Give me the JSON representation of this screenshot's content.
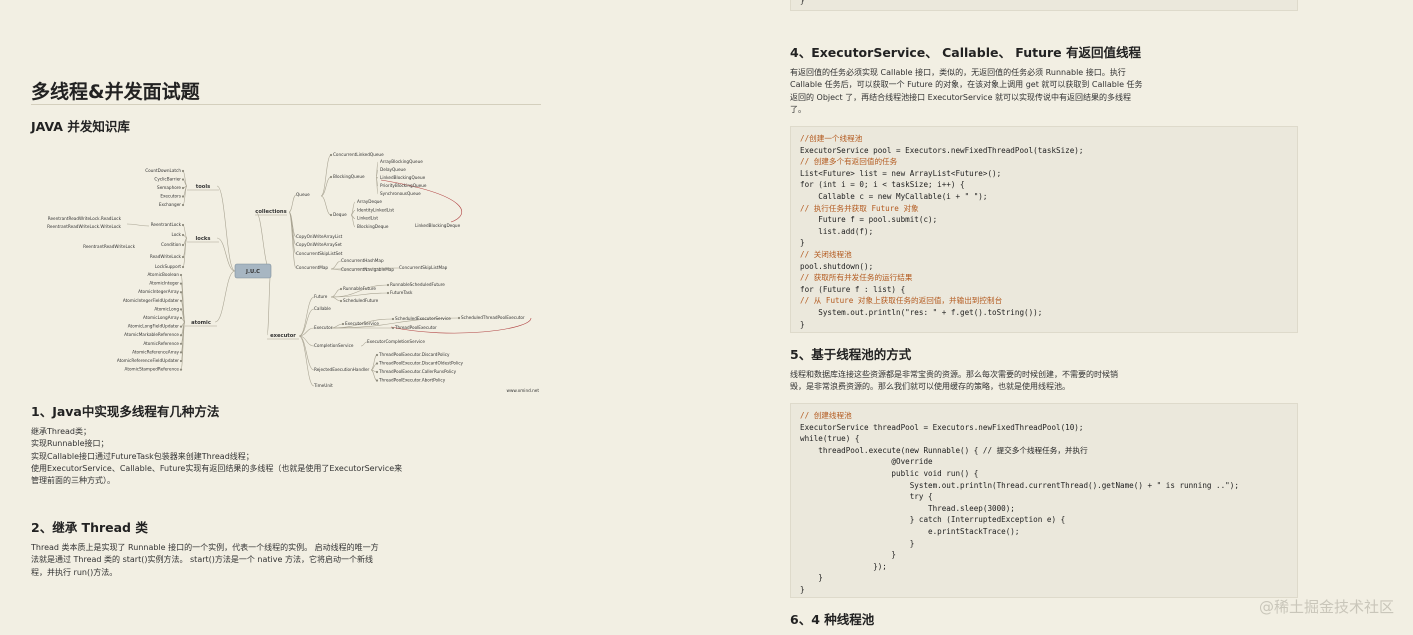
{
  "left": {
    "title": "多线程&并发面试题",
    "subtitle": "JAVA 并发知识库",
    "mindmap": {
      "center": "J.U.C",
      "categories": [
        "tools",
        "locks",
        "atomic",
        "collections",
        "executor"
      ],
      "tools_items": [
        "CountDownLatch",
        "CyclicBarrier",
        "Semaphore",
        "Executors",
        "Exchanger"
      ],
      "locks_items": [
        "ReentrantLock",
        "Lock",
        "Condition",
        "ReadWriteLock",
        "LockSupport"
      ],
      "locks_sub": [
        "ReentrantReadWriteLock.ReadLock",
        "ReentrantReadWriteLock.WriteLock",
        "ReentrantReadWriteLock"
      ],
      "atomic_items": [
        "AtomicBoolean",
        "AtomicInteger",
        "AtomicIntegerArray",
        "AtomicIntegerFieldUpdater",
        "AtomicLong",
        "AtomicLongArray",
        "AtomicLongFieldUpdater",
        "AtomicMarkableReference",
        "AtomicReference",
        "AtomicReferenceArray",
        "AtomicReferenceFieldUpdater",
        "AtomicStampedReference"
      ],
      "collections_items": [
        "Queue",
        "CopyOnWriteArrayList",
        "CopyOnWriteArraySet",
        "ConcurrentSkipListSet",
        "ConcurrentMap"
      ],
      "queue_items": [
        "ConcurrentLinkedQueue",
        "BlockingQueue",
        "Deque"
      ],
      "blockingqueue_items": [
        "ArrayBlockingQueue",
        "DelayQueue",
        "LinkedBlockingQueue",
        "PriorityBlockingQueue",
        "SynchronousQueue"
      ],
      "deque_items": [
        "ArrayDeque",
        "IdentityLinkedList",
        "LinkedList",
        "BlockingDeque"
      ],
      "blockingdeque_items": [
        "LinkedBlockingDeque"
      ],
      "map_items": [
        "ConcurrentHashMap",
        "ConcurrentNavigableMap",
        "ConcurrentSkipListMap"
      ],
      "executor_items": [
        "Future",
        "Callable",
        "Executor",
        "CompletionService",
        "RejectedExecutionHandler",
        "TimeUnit"
      ],
      "future_items": [
        "RunnableFuture",
        "ScheduledFuture",
        "RunnableScheduledFuture",
        "FutureTask"
      ],
      "executor_sub": [
        "ExecutorService",
        "ScheduledExecutorService",
        "ThreadPoolExecutor",
        "ScheduledThreadPoolExecutor"
      ],
      "completion_items": [
        "ExecutorCompletionService"
      ],
      "rejected_items": [
        "ThreadPoolExecutor.DiscardPolicy",
        "ThreadPoolExecutor.DiscardOldestPolicy",
        "ThreadPoolExecutor.CallerRunsPolicy",
        "ThreadPoolExecutor.AbortPolicy"
      ],
      "credit": "www.xmind.net"
    },
    "sec1": {
      "title": "1、Java中实现多线程有几种方法",
      "lines": [
        "继承Thread类；",
        "实现Runnable接口；",
        "实现Callable接口通过FutureTask包装器来创建Thread线程；",
        "使用ExecutorService、Callable、Future实现有返回结果的多线程（也就是使用了ExecutorService来",
        "管理前面的三种方式）。"
      ]
    },
    "sec2": {
      "title": "2、继承 Thread 类",
      "lines": [
        "Thread 类本质上是实现了 Runnable 接口的一个实例，代表一个线程的实例。 启动线程的唯一方",
        "法就是通过 Thread 类的 start()实例方法。 start()方法是一个 native 方法，它将启动一个新线",
        "程，并执行 run()方法。"
      ]
    }
  },
  "right": {
    "top_code_tail": "}",
    "sec4": {
      "title": "4、ExecutorService、 Callable、 Future 有返回值线程",
      "lines": [
        "有返回值的任务必须实现 Callable 接口，类似的，无返回值的任务必须 Runnable 接口。执行",
        "Callable 任务后，可以获取一个 Future 的对象，在该对象上调用 get 就可以获取到 Callable 任务",
        "返回的 Object 了，再结合线程池接口 ExecutorService 就可以实现传说中有返回结果的多线程",
        "了。"
      ],
      "code": [
        {
          "t": "//创建一个线程池",
          "c": true
        },
        {
          "t": "ExecutorService pool = Executors.newFixedThreadPool(taskSize);",
          "c": false
        },
        {
          "t": "// 创建多个有返回值的任务",
          "c": true
        },
        {
          "t": "List<Future> list = new ArrayList<Future>();",
          "c": false
        },
        {
          "t": "for (int i = 0; i < taskSize; i++) {",
          "c": false
        },
        {
          "t": "    Callable c = new MyCallable(i + \" \");",
          "c": false
        },
        {
          "t": "// 执行任务并获取 Future 对象",
          "c": true
        },
        {
          "t": "    Future f = pool.submit(c);",
          "c": false
        },
        {
          "t": "    list.add(f);",
          "c": false
        },
        {
          "t": "}",
          "c": false
        },
        {
          "t": "// 关闭线程池",
          "c": true
        },
        {
          "t": "pool.shutdown();",
          "c": false
        },
        {
          "t": "// 获取所有并发任务的运行结果",
          "c": true
        },
        {
          "t": "for (Future f : list) {",
          "c": false
        },
        {
          "t": "// 从 Future 对象上获取任务的返回值，并输出到控制台",
          "c": true
        },
        {
          "t": "    System.out.println(\"res: \" + f.get().toString());",
          "c": false
        },
        {
          "t": "}",
          "c": false
        }
      ]
    },
    "sec5": {
      "title": "5、基于线程池的方式",
      "lines": [
        "线程和数据库连接这些资源都是非常宝贵的资源。那么每次需要的时候创建，不需要的时候销",
        "毁，是非常浪费资源的。那么我们就可以使用缓存的策略，也就是使用线程池。"
      ],
      "code": [
        {
          "t": "// 创建线程池",
          "c": true
        },
        {
          "t": "ExecutorService threadPool = Executors.newFixedThreadPool(10);",
          "c": false
        },
        {
          "t": "while(true) {",
          "c": false
        },
        {
          "t": "    threadPool.execute(new Runnable() { // 提交多个线程任务，并执行",
          "c": false
        },
        {
          "t": "                    @Override",
          "c": false
        },
        {
          "t": "                    public void run() {",
          "c": false
        },
        {
          "t": "                        System.out.println(Thread.currentThread().getName() + \" is running ..\");",
          "c": false
        },
        {
          "t": "                        try {",
          "c": false
        },
        {
          "t": "                            Thread.sleep(3000);",
          "c": false
        },
        {
          "t": "                        } catch (InterruptedException e) {",
          "c": false
        },
        {
          "t": "                            e.printStackTrace();",
          "c": false
        },
        {
          "t": "                        }",
          "c": false
        },
        {
          "t": "                    }",
          "c": false
        },
        {
          "t": "                });",
          "c": false
        },
        {
          "t": "    }",
          "c": false
        },
        {
          "t": "}",
          "c": false
        }
      ]
    },
    "sec6": {
      "title": "6、4 种线程池"
    }
  },
  "watermark": "@稀土掘金技术社区"
}
